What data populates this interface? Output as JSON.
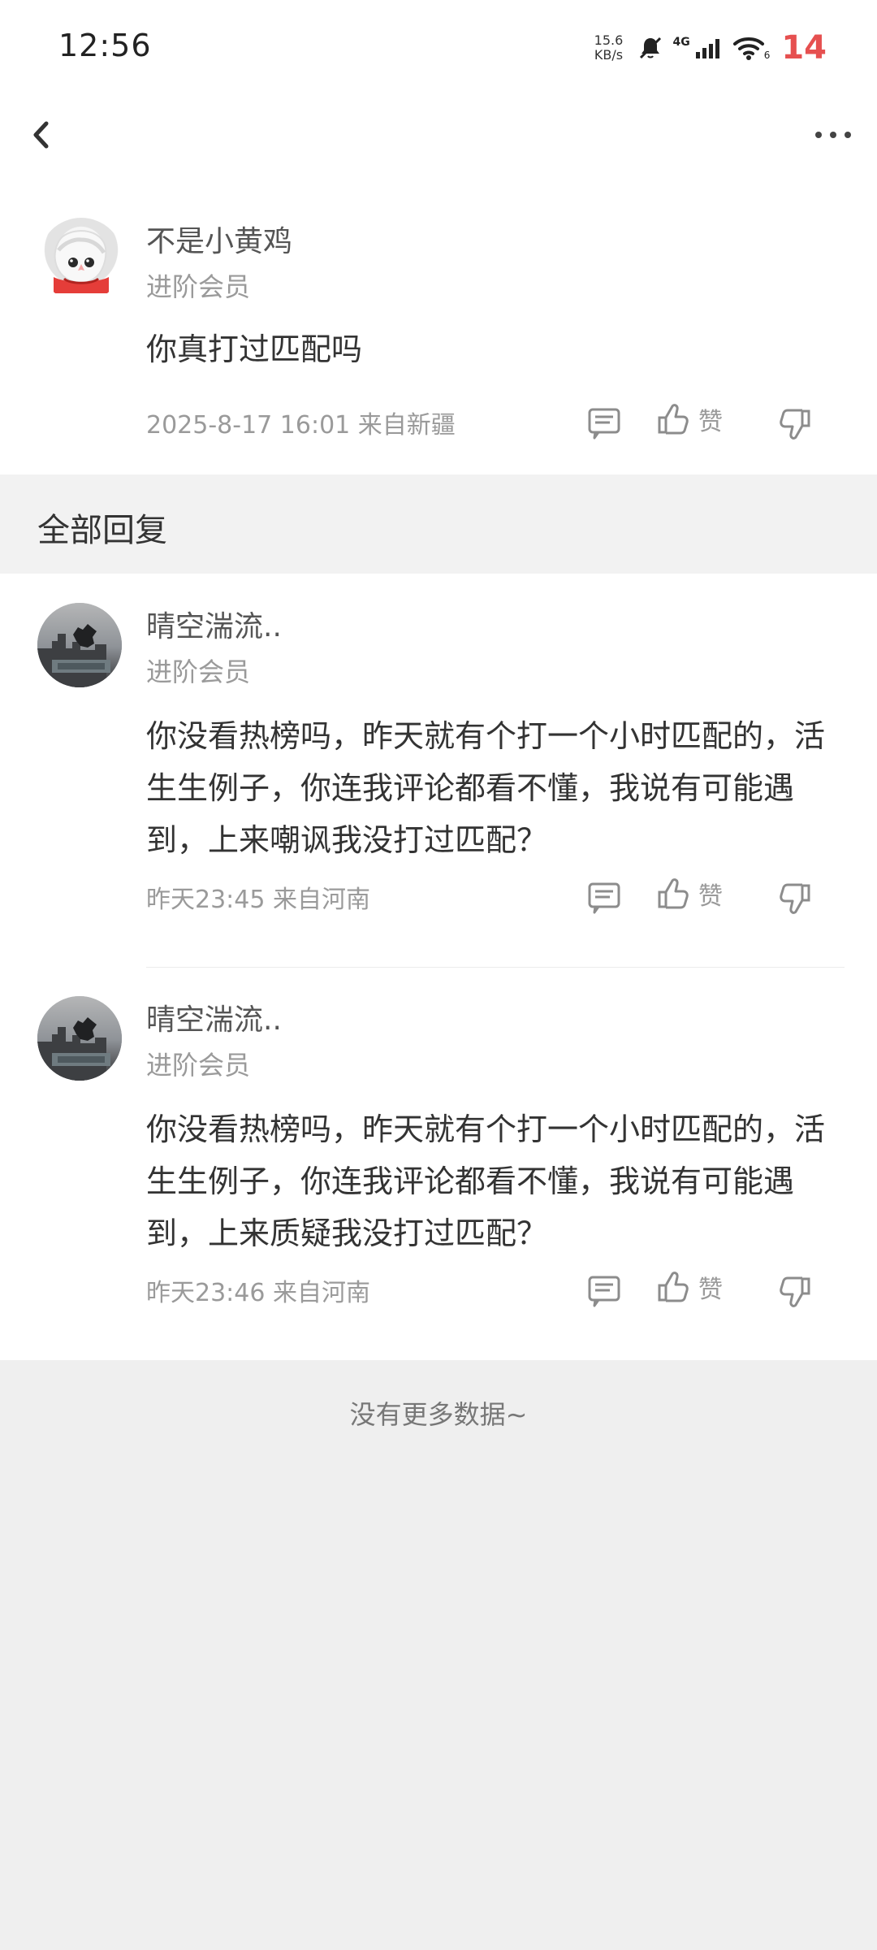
{
  "status": {
    "time": "12:56",
    "network_speed_top": "15.6",
    "network_speed_bottom": "KB/s",
    "signal_label": "4G",
    "wifi_label": "6",
    "battery": "14"
  },
  "nav": {
    "back_icon": "chevron-left-icon",
    "more_icon": "more-horizontal-icon"
  },
  "main_comment": {
    "username": "不是小黄鸡",
    "member": "进阶会员",
    "content": "你真打过匹配吗",
    "meta": "2025-8-17 16:01 来自新疆",
    "like_label": "赞"
  },
  "replies_section": {
    "title": "全部回复"
  },
  "replies": [
    {
      "username": "晴空湍流..",
      "member": "进阶会员",
      "content": "你没看热榜吗，昨天就有个打一个小时匹配的，活生生例子，你连我评论都看不懂，我说有可能遇到，上来嘲讽我没打过匹配？",
      "meta": "昨天23:45 来自河南",
      "like_label": "赞"
    },
    {
      "username": "晴空湍流..",
      "member": "进阶会员",
      "content": "你没看热榜吗，昨天就有个打一个小时匹配的，活生生例子，你连我评论都看不懂，我说有可能遇到，上来质疑我没打过匹配？",
      "meta": "昨天23:46 来自河南",
      "like_label": "赞"
    }
  ],
  "footer": {
    "text": "没有更多数据~"
  }
}
